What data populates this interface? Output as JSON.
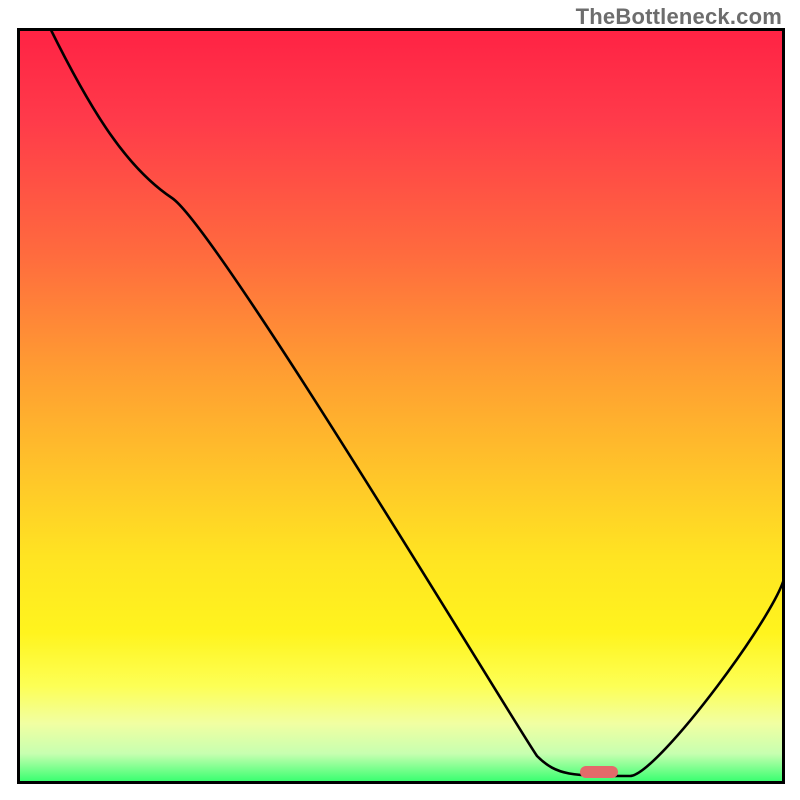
{
  "watermark": "TheBottleneck.com",
  "chart_data": {
    "type": "line",
    "title": "",
    "xlabel": "",
    "ylabel": "",
    "x_range": [
      0,
      100
    ],
    "y_range": [
      0,
      100
    ],
    "grid": false,
    "legend": false,
    "background_gradient": {
      "orientation": "vertical",
      "stops": [
        {
          "pos": 0.0,
          "color": "#ff2244"
        },
        {
          "pos": 0.12,
          "color": "#ff3a4a"
        },
        {
          "pos": 0.3,
          "color": "#ff6b3e"
        },
        {
          "pos": 0.45,
          "color": "#ff9c32"
        },
        {
          "pos": 0.58,
          "color": "#ffc22a"
        },
        {
          "pos": 0.7,
          "color": "#ffe422"
        },
        {
          "pos": 0.8,
          "color": "#fff41e"
        },
        {
          "pos": 0.87,
          "color": "#fdff55"
        },
        {
          "pos": 0.92,
          "color": "#f1ffa2"
        },
        {
          "pos": 0.96,
          "color": "#c7ffb0"
        },
        {
          "pos": 1.0,
          "color": "#2cff6a"
        }
      ]
    },
    "series": [
      {
        "name": "bottleneck-curve",
        "color": "#000000",
        "points": [
          {
            "x": 4,
            "y": 100
          },
          {
            "x": 20,
            "y": 78
          },
          {
            "x": 68,
            "y": 3
          },
          {
            "x": 72,
            "y": 1
          },
          {
            "x": 80,
            "y": 1
          },
          {
            "x": 100,
            "y": 28
          }
        ]
      }
    ],
    "markers": [
      {
        "name": "optimal-marker",
        "shape": "rounded-bar",
        "color": "#e46a6a",
        "x": 76,
        "y": 1,
        "width_pct": 5,
        "height_pct": 1.6
      }
    ]
  }
}
